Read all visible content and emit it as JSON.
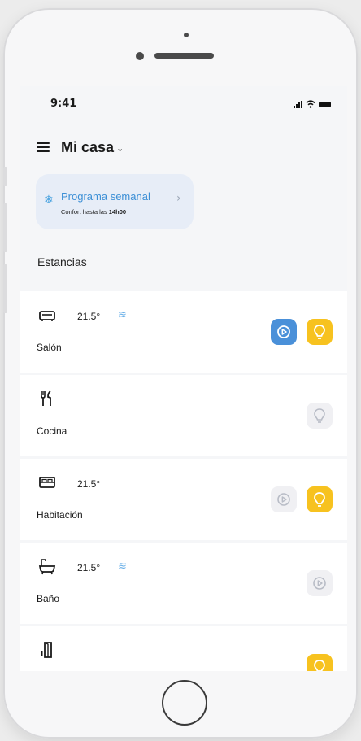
{
  "status_bar": {
    "time": "9:41"
  },
  "header": {
    "title": "Mi casa",
    "chevron": "⌄"
  },
  "schedule_card": {
    "title": "Programa semanal",
    "subtitle_prefix": "Confort hasta las",
    "subtitle_time": "14h00",
    "icon": "snowflake-icon",
    "chevron": "›"
  },
  "rooms_section": {
    "title": "Estancias"
  },
  "rooms": [
    {
      "name": "Salón",
      "temperature": "21.5°",
      "icon": "sofa-icon",
      "fan": true,
      "actions": [
        "play-active",
        "light-active"
      ]
    },
    {
      "name": "Cocina",
      "temperature": "",
      "icon": "cutlery-icon",
      "fan": false,
      "actions": [
        "light-inactive"
      ]
    },
    {
      "name": "Habitación",
      "temperature": "21.5°",
      "icon": "bed-icon",
      "fan": false,
      "actions": [
        "play-inactive",
        "light-active"
      ]
    },
    {
      "name": "Baño",
      "temperature": "21.5°",
      "icon": "bathtub-icon",
      "fan": true,
      "actions": [
        "play-inactive"
      ]
    },
    {
      "name": "",
      "temperature": "",
      "icon": "door-icon",
      "fan": false,
      "actions": [
        "light-active"
      ]
    }
  ],
  "colors": {
    "accent_blue": "#4a90d9",
    "accent_yellow": "#f7c21f",
    "card_bg": "#e7edf7",
    "link_blue": "#3c8fd6"
  }
}
